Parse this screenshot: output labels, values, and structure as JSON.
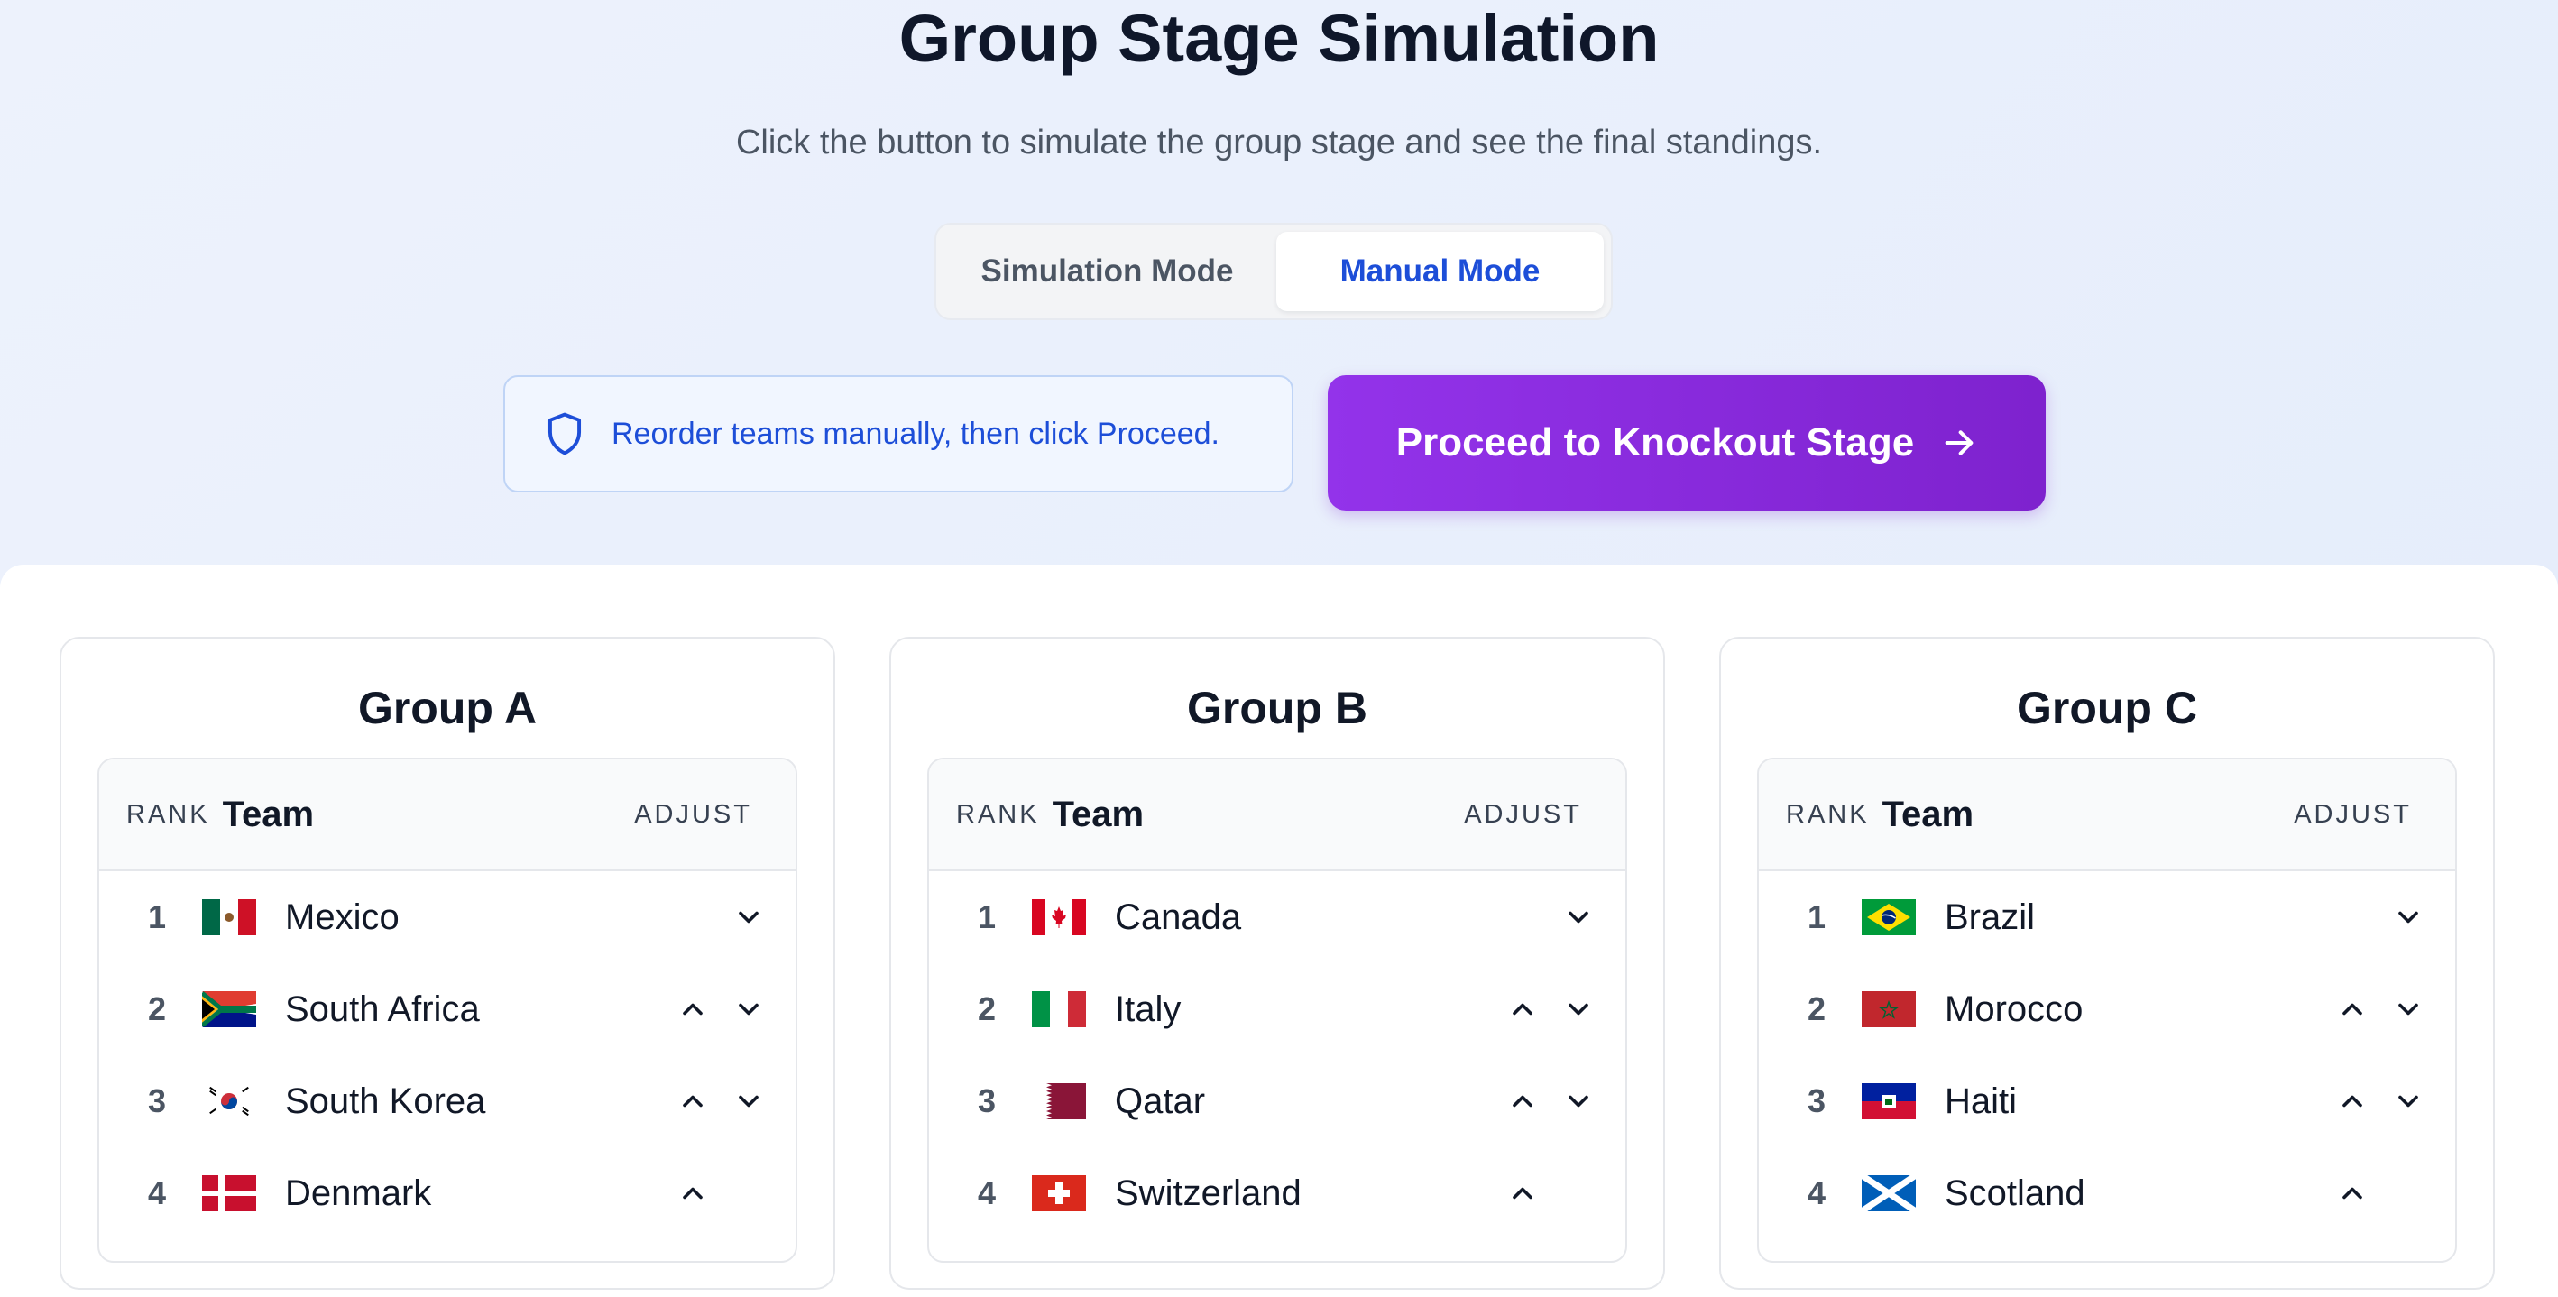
{
  "header": {
    "title": "Group Stage Simulation",
    "subtitle": "Click the button to simulate the group stage and see the final standings."
  },
  "mode_toggle": {
    "simulation_label": "Simulation Mode",
    "manual_label": "Manual Mode",
    "active": "manual"
  },
  "info": {
    "text": "Reorder teams manually, then click Proceed."
  },
  "proceed": {
    "label": "Proceed to Knockout Stage"
  },
  "table_headers": {
    "rank": "RANK",
    "team": "Team",
    "adjust": "ADJUST"
  },
  "colors": {
    "accent": "#7e22ce",
    "info_text": "#1d4ed8",
    "border": "#e5e7eb"
  },
  "groups": [
    {
      "name": "Group A",
      "teams": [
        {
          "rank": "1",
          "name": "Mexico",
          "flag": "mexico-flag-icon"
        },
        {
          "rank": "2",
          "name": "South Africa",
          "flag": "south-africa-flag-icon"
        },
        {
          "rank": "3",
          "name": "South Korea",
          "flag": "south-korea-flag-icon"
        },
        {
          "rank": "4",
          "name": "Denmark",
          "flag": "denmark-flag-icon"
        }
      ]
    },
    {
      "name": "Group B",
      "teams": [
        {
          "rank": "1",
          "name": "Canada",
          "flag": "canada-flag-icon"
        },
        {
          "rank": "2",
          "name": "Italy",
          "flag": "italy-flag-icon"
        },
        {
          "rank": "3",
          "name": "Qatar",
          "flag": "qatar-flag-icon"
        },
        {
          "rank": "4",
          "name": "Switzerland",
          "flag": "switzerland-flag-icon"
        }
      ]
    },
    {
      "name": "Group C",
      "teams": [
        {
          "rank": "1",
          "name": "Brazil",
          "flag": "brazil-flag-icon"
        },
        {
          "rank": "2",
          "name": "Morocco",
          "flag": "morocco-flag-icon"
        },
        {
          "rank": "3",
          "name": "Haiti",
          "flag": "haiti-flag-icon"
        },
        {
          "rank": "4",
          "name": "Scotland",
          "flag": "scotland-flag-icon"
        }
      ]
    }
  ]
}
